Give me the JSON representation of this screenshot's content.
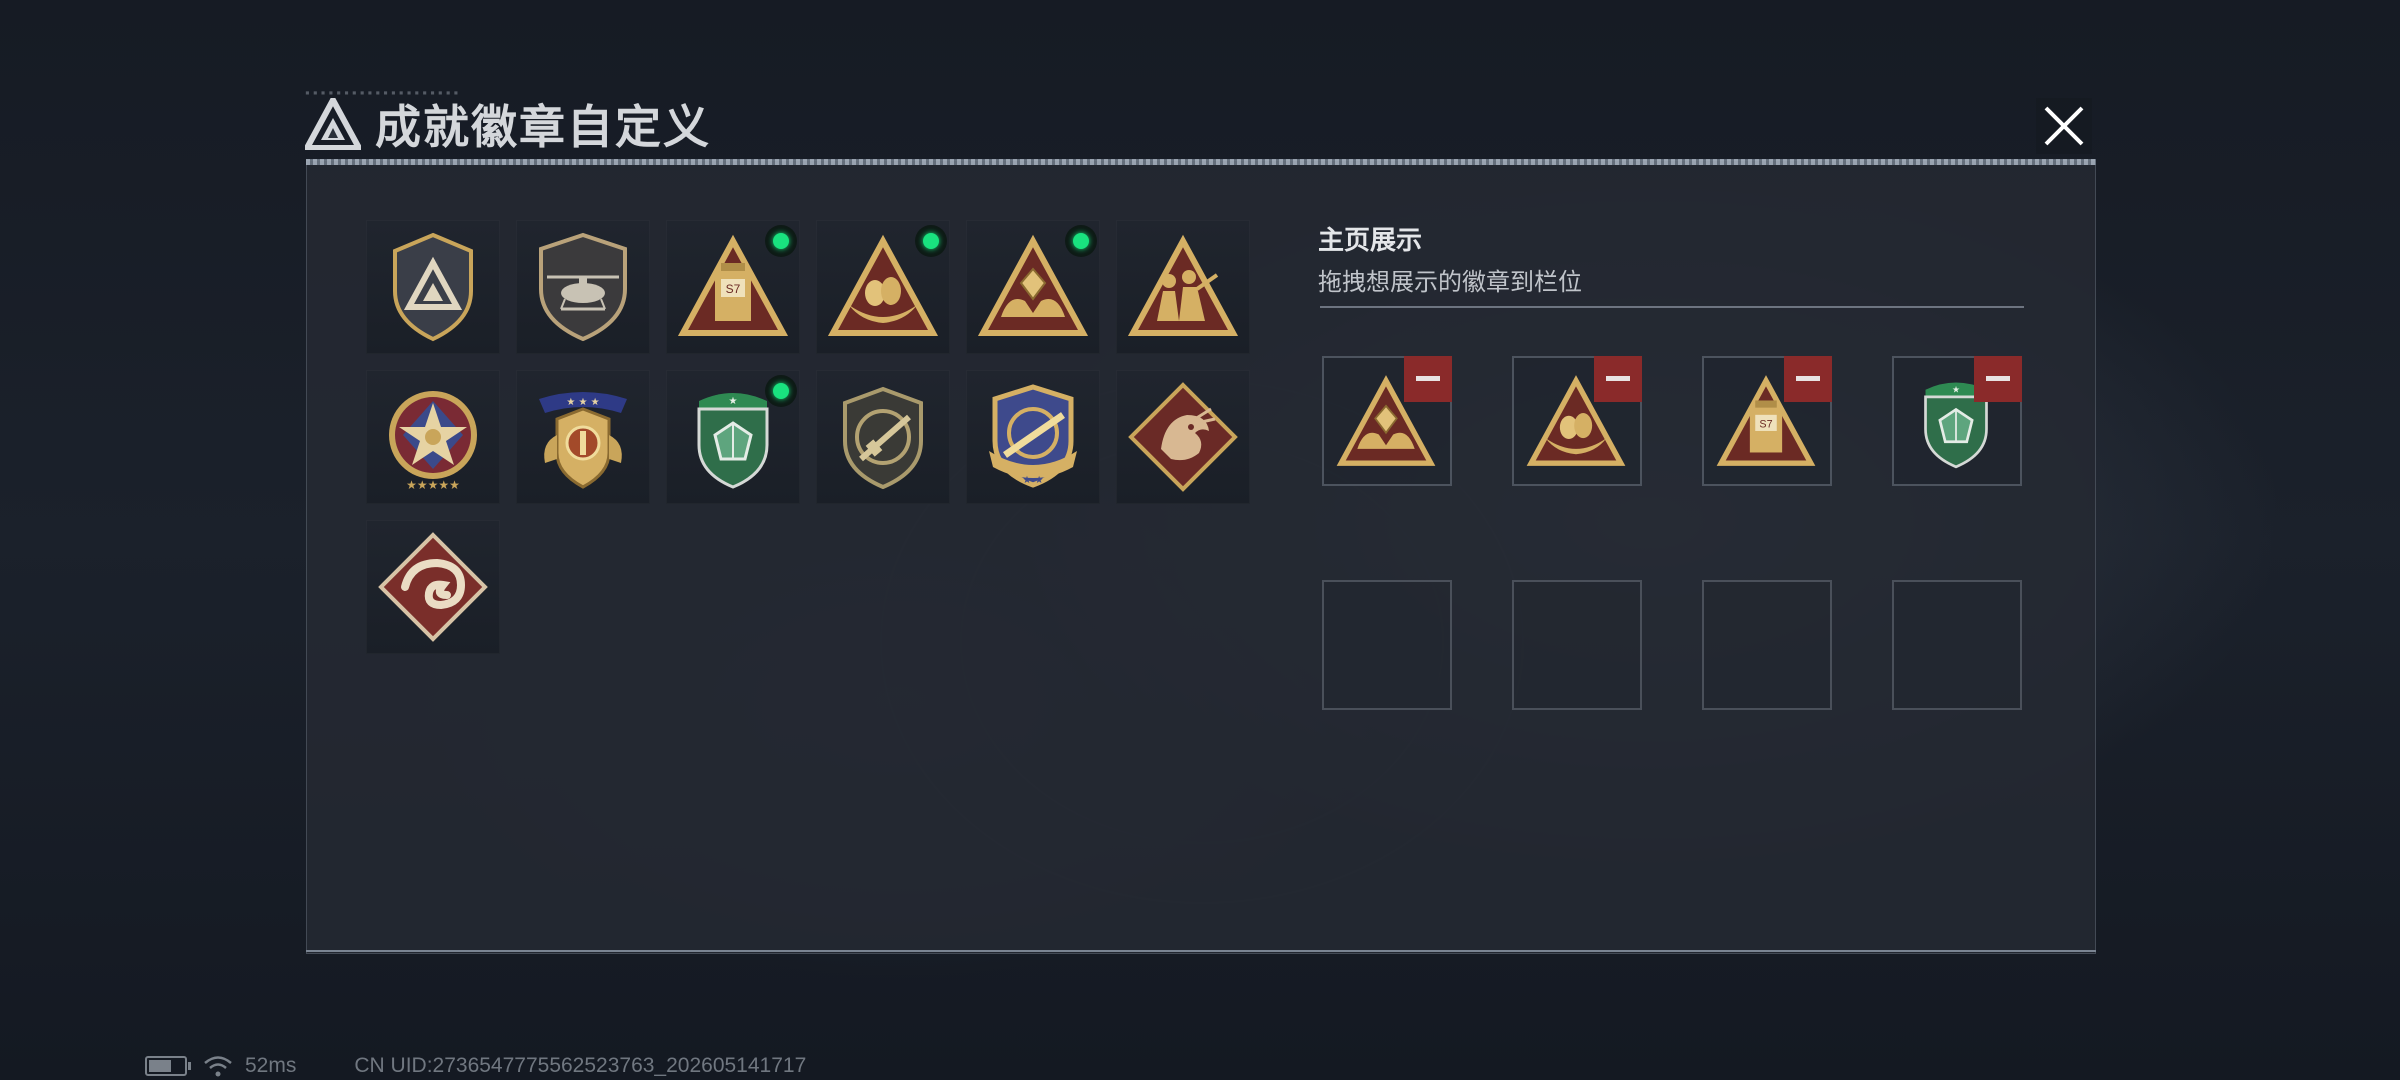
{
  "dialog": {
    "title": "成就徽章自定义",
    "close_label": "close"
  },
  "badges": [
    {
      "icon": "triangle-logo-shield-badge",
      "new": false
    },
    {
      "icon": "helicopter-shield-badge",
      "new": false
    },
    {
      "icon": "s7-bottle-triangle-badge",
      "new": true
    },
    {
      "icon": "eggs-nest-triangle-badge",
      "new": true
    },
    {
      "icon": "hands-gem-triangle-badge",
      "new": true
    },
    {
      "icon": "soldiers-triangle-badge",
      "new": false
    },
    {
      "icon": "star-medal-badge",
      "new": false
    },
    {
      "icon": "winged-crest-badge",
      "new": false
    },
    {
      "icon": "green-gem-shield-badge",
      "new": true
    },
    {
      "icon": "rifle-shield-badge",
      "new": false
    },
    {
      "icon": "rocket-crest-badge",
      "new": false
    },
    {
      "icon": "dragon-diamond-badge",
      "new": false
    },
    {
      "icon": "snake-diamond-badge",
      "new": false
    }
  ],
  "display": {
    "title": "主页展示",
    "subtitle": "拖拽想展示的徽章到栏位",
    "slots": [
      {
        "icon": "hands-gem-triangle-badge"
      },
      {
        "icon": "eggs-nest-triangle-badge"
      },
      {
        "icon": "s7-bottle-triangle-badge"
      },
      {
        "icon": "green-gem-shield-badge"
      },
      {
        "icon": ""
      },
      {
        "icon": ""
      },
      {
        "icon": ""
      },
      {
        "icon": ""
      }
    ]
  },
  "status": {
    "ping": "52ms",
    "uid": "CN UID:27365477755625237​63_202605141717"
  },
  "colors": {
    "new_dot": "#19e27f",
    "remove_button": "#8a2a2a",
    "gold": "#c9a55a"
  }
}
